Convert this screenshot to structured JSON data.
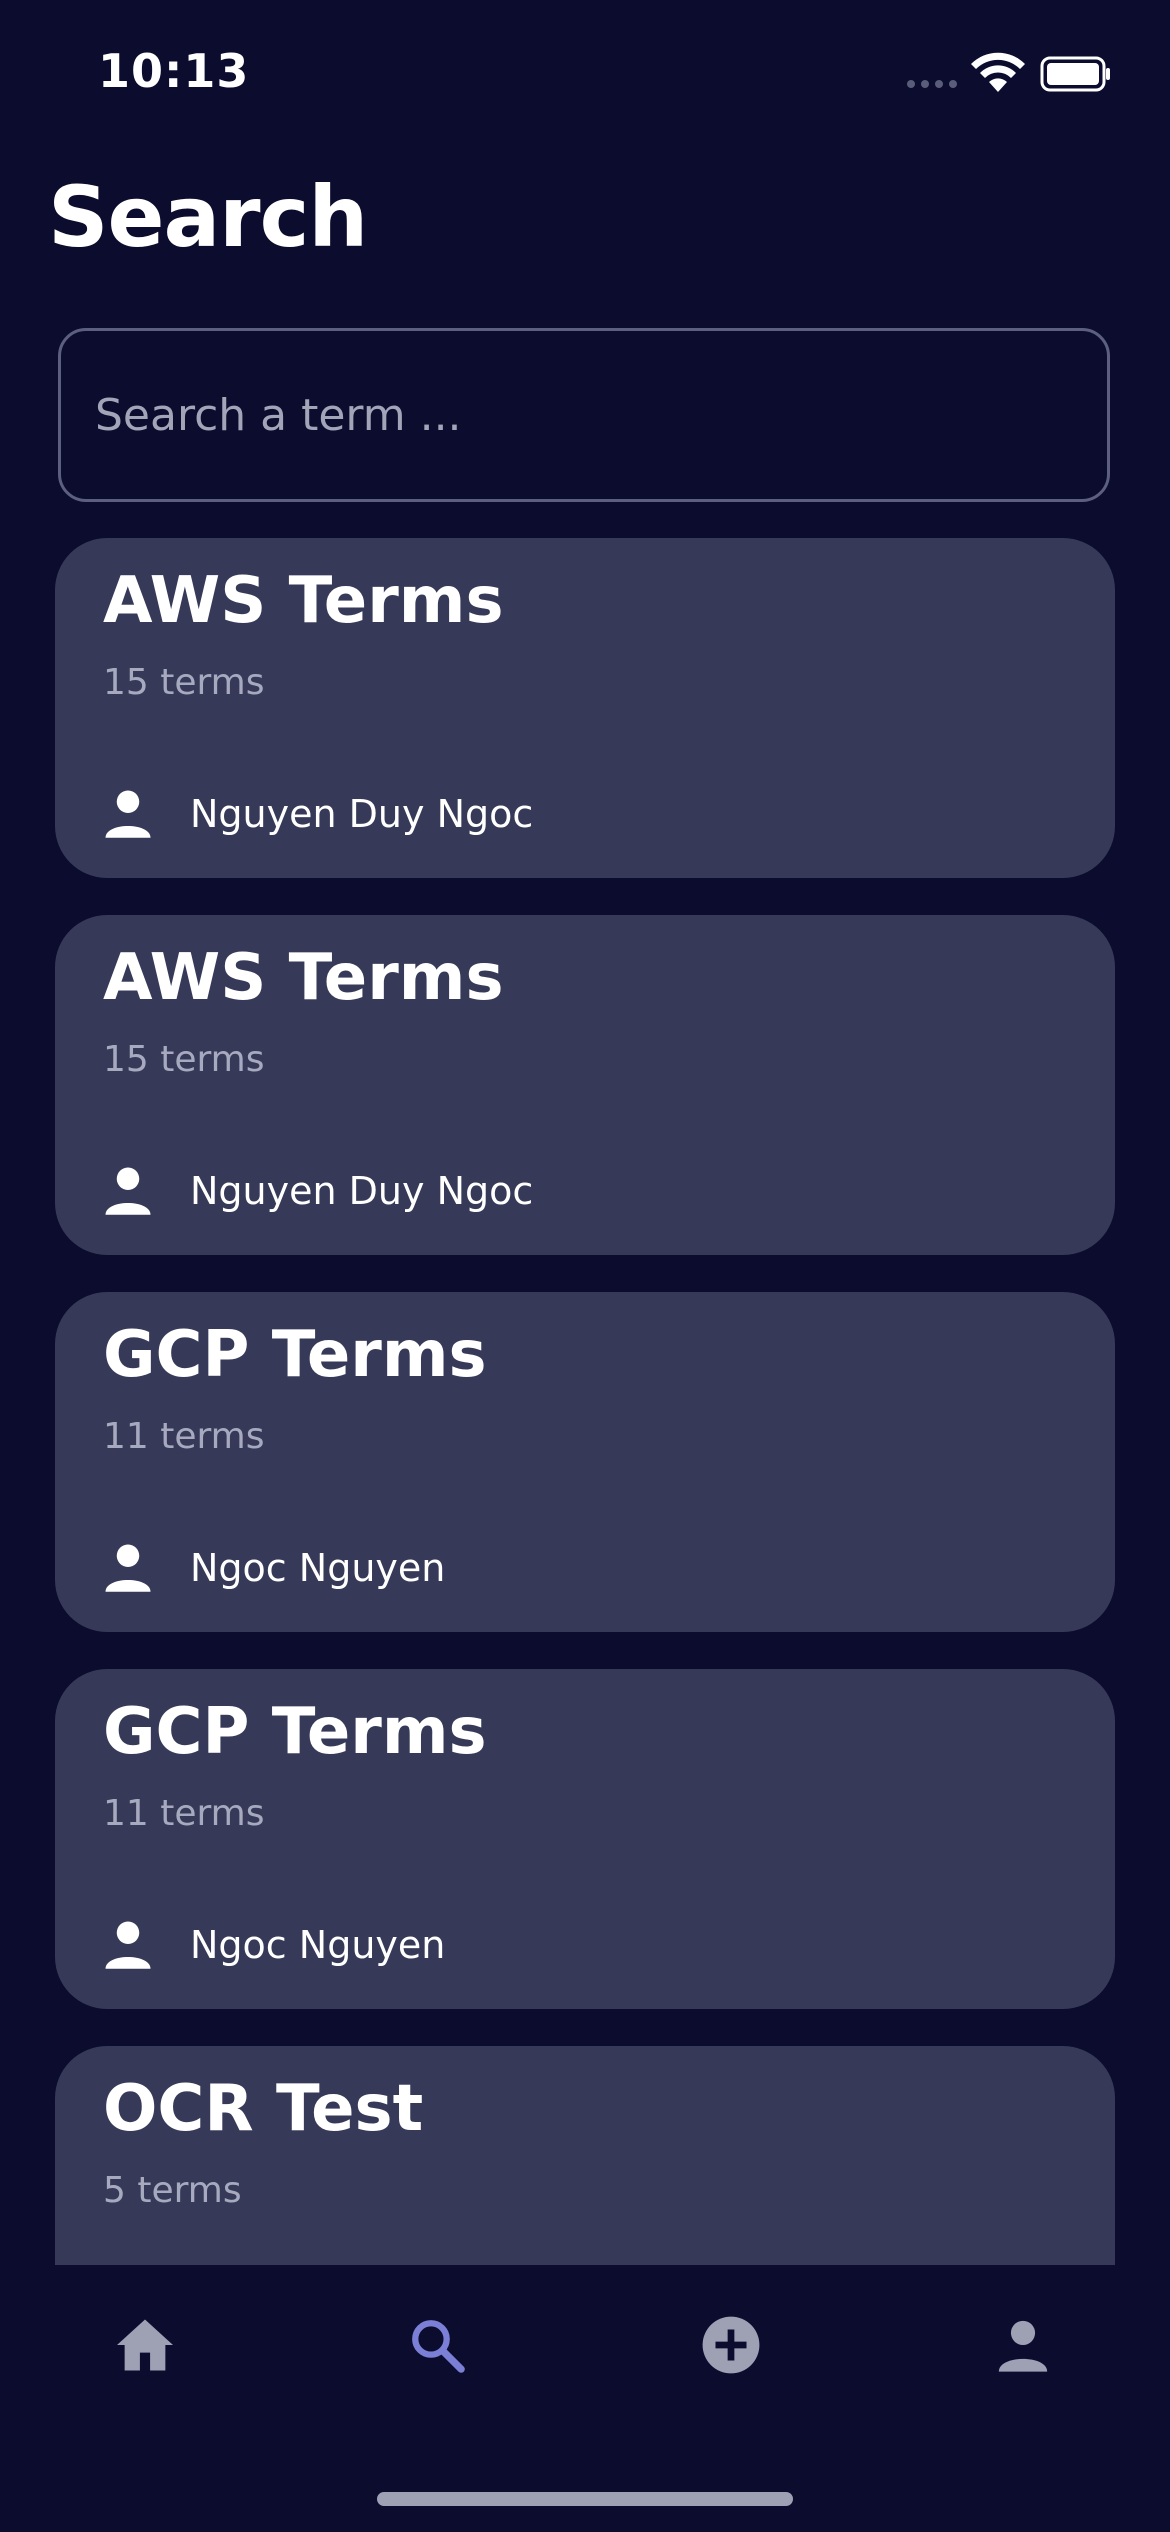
{
  "status_bar": {
    "time": "10:13"
  },
  "page": {
    "title": "Search"
  },
  "search": {
    "placeholder": "Search a term ..."
  },
  "results": [
    {
      "title": "AWS Terms",
      "count": "15 terms",
      "author": "Nguyen Duy Ngoc"
    },
    {
      "title": "AWS Terms",
      "count": "15 terms",
      "author": "Nguyen Duy Ngoc"
    },
    {
      "title": "GCP Terms",
      "count": "11 terms",
      "author": "Ngoc Nguyen"
    },
    {
      "title": "GCP Terms",
      "count": "11 terms",
      "author": "Ngoc Nguyen"
    },
    {
      "title": "OCR Test",
      "count": "5 terms",
      "author": ""
    }
  ],
  "nav": {
    "items": [
      {
        "icon": "home-icon",
        "active": false
      },
      {
        "icon": "search-icon",
        "active": true
      },
      {
        "icon": "add-circle-icon",
        "active": false
      },
      {
        "icon": "profile-icon",
        "active": false
      }
    ],
    "active_color": "#7b80d6",
    "inactive_color": "#9ea0b4"
  },
  "colors": {
    "background": "#0b0c2e",
    "card": "#363a58",
    "muted_text": "#a7aabf",
    "accent": "#7b80d6"
  }
}
